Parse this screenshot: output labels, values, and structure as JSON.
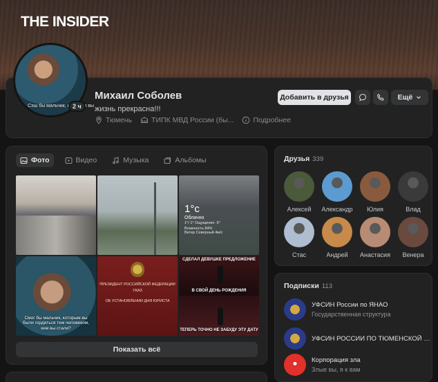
{
  "watermark": "THE INSIDER",
  "profile": {
    "name": "Михаил Соболев",
    "status": "жизнь прекрасна!!!",
    "avatar_caption": "Сэш бы мальчик, которым вы",
    "avatar_badge": "2 ч",
    "city": "Тюмень",
    "education": "ТИПК МВД России (бы...",
    "more_info": "Подробнее"
  },
  "actions": {
    "add_friend": "Добавить в друзья",
    "more": "Ещё"
  },
  "media": {
    "tabs": [
      {
        "label": "Фото",
        "active": true,
        "icon": "photo-icon"
      },
      {
        "label": "Видео",
        "active": false,
        "icon": "video-icon"
      },
      {
        "label": "Музыка",
        "active": false,
        "icon": "music-icon"
      },
      {
        "label": "Альбомы",
        "active": false,
        "icon": "albums-icon"
      }
    ],
    "show_all": "Показать всё",
    "weather": {
      "temp": "1°c",
      "line1": "Облачно",
      "line2": "1°/ 1°  Ощущение -5°",
      "line3": "Влажность 84%",
      "line4": "Ветер Северный 4м/с"
    },
    "decree": {
      "line1": "ПРЕЗИДЕНТ РОССИЙСКОЙ ФЕДЕРАЦИИ",
      "line2": "УКАЗ",
      "line3": "ОБ УСТАНОВЛЕНИИ ДНЯ ЮРИСТА"
    },
    "meme": {
      "line1": "СДЕЛАЛ ДЕВУШКЕ ПРЕДЛОЖЕНИЕ",
      "line2": "В СВОЙ ДЕНЬ РОЖДЕНИЯ",
      "line3": "ТЕПЕРЬ ТОЧНО НЕ ЗАБУДУ ЭТУ ДАТУ"
    },
    "boy_caption": "Смог бы мальчик, которым вы были гордиться тем человеком, кем вы стали?"
  },
  "friends": {
    "title": "Друзья",
    "count": "339",
    "items": [
      {
        "name": "Алексей",
        "color": "#4a5a3a"
      },
      {
        "name": "Александр",
        "color": "#5b9bd1"
      },
      {
        "name": "Юлия",
        "color": "#8a5a3e"
      },
      {
        "name": "Влад",
        "color": "#3a3a3a"
      },
      {
        "name": "Стас",
        "color": "#aebdcf"
      },
      {
        "name": "Андрей",
        "color": "#c78a4a"
      },
      {
        "name": "Анастасия",
        "color": "#b88b74"
      },
      {
        "name": "Венера",
        "color": "#6a4a3e"
      }
    ]
  },
  "subscriptions": {
    "title": "Подписки",
    "count": "113",
    "items": [
      {
        "name": "УФСИН России по ЯНАО",
        "desc": "Государственная структура"
      },
      {
        "name": "УФСИН РОССИИ ПО ТЮМЕНСКОЙ ОБ...",
        "desc": ""
      },
      {
        "name": "Корпорация зла",
        "desc": "Злые вы, я к вам"
      }
    ]
  }
}
